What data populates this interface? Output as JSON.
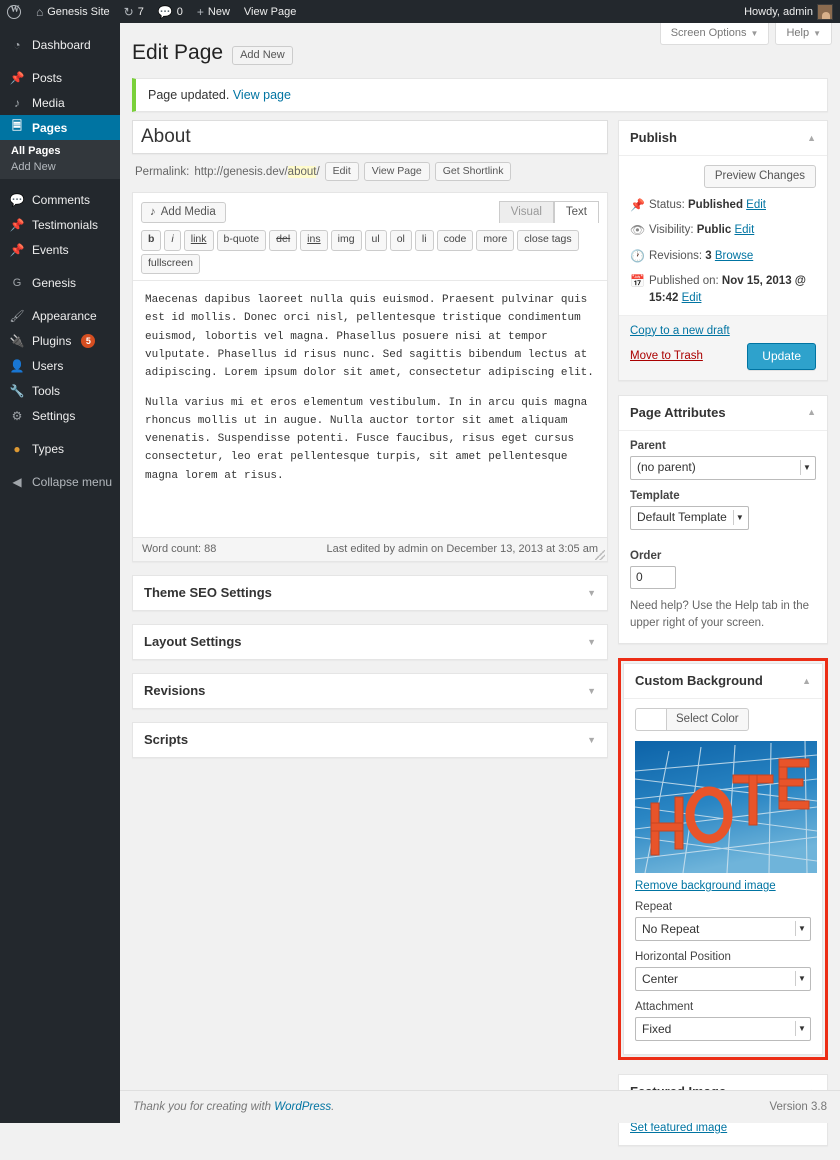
{
  "adminbar": {
    "logo_icon": "wordpress-logo-icon",
    "site_name": "Genesis Site",
    "updates_count": "7",
    "comments_count": "0",
    "new_label": "New",
    "view_page_label": "View Page",
    "howdy": "Howdy, admin"
  },
  "sidebar": {
    "items": [
      {
        "label": "Dashboard",
        "icon": "dashboard-icon"
      },
      {
        "label": "Posts",
        "icon": "pin-icon"
      },
      {
        "label": "Media",
        "icon": "media-icon"
      },
      {
        "label": "Pages",
        "icon": "pages-icon",
        "current": true
      },
      {
        "label": "Comments",
        "icon": "comment-icon"
      },
      {
        "label": "Testimonials",
        "icon": "pin-icon"
      },
      {
        "label": "Events",
        "icon": "pin-icon"
      },
      {
        "label": "Genesis",
        "icon": "genesis-icon"
      },
      {
        "label": "Appearance",
        "icon": "brush-icon"
      },
      {
        "label": "Plugins",
        "icon": "plug-icon",
        "badge": "5"
      },
      {
        "label": "Users",
        "icon": "user-icon"
      },
      {
        "label": "Tools",
        "icon": "wrench-icon"
      },
      {
        "label": "Settings",
        "icon": "settings-icon"
      },
      {
        "label": "Types",
        "icon": "types-icon"
      },
      {
        "label": "Collapse menu",
        "icon": "collapse-icon"
      }
    ],
    "pages_submenu": [
      {
        "label": "All Pages",
        "current": true
      },
      {
        "label": "Add New",
        "current": false
      }
    ]
  },
  "screen_meta": {
    "screen_options": "Screen Options",
    "help": "Help"
  },
  "header": {
    "title": "Edit Page",
    "add_new": "Add New"
  },
  "notice": {
    "text": "Page updated.",
    "link": "View page"
  },
  "post": {
    "title": "About",
    "permalink_label": "Permalink:",
    "permalink_base": "http://genesis.dev/",
    "permalink_slug": "about",
    "permalink_tail": "/",
    "edit_btn": "Edit",
    "view_page_btn": "View Page",
    "get_shortlink_btn": "Get Shortlink"
  },
  "editor": {
    "add_media": "Add Media",
    "tab_visual": "Visual",
    "tab_text": "Text",
    "active_tab": "Text",
    "quicktags": [
      "b",
      "i",
      "link",
      "b-quote",
      "del",
      "ins",
      "img",
      "ul",
      "ol",
      "li",
      "code",
      "more",
      "close tags",
      "fullscreen"
    ],
    "paragraphs": [
      "Maecenas dapibus laoreet nulla quis euismod. Praesent pulvinar quis est id mollis. Donec orci nisl, pellentesque tristique condimentum euismod, lobortis vel magna. Phasellus posuere nisi at tempor vulputate. Phasellus id risus nunc. Sed sagittis bibendum lectus at adipiscing. Lorem ipsum dolor sit amet, consectetur adipiscing elit.",
      "Nulla varius mi et eros elementum vestibulum. In in arcu quis magna rhoncus mollis ut in augue. Nulla auctor tortor sit amet aliquam venenatis. Suspendisse potenti. Fusce faucibus, risus eget cursus consectetur, leo erat pellentesque turpis, sit amet pellentesque magna lorem at risus."
    ],
    "word_count": "Word count: 88",
    "last_edited": "Last edited by admin on December 13, 2013 at 3:05 am"
  },
  "metaboxes": [
    {
      "title": "Theme SEO Settings"
    },
    {
      "title": "Layout Settings"
    },
    {
      "title": "Revisions"
    },
    {
      "title": "Scripts"
    }
  ],
  "publish": {
    "title": "Publish",
    "preview_changes": "Preview Changes",
    "status_label": "Status:",
    "status_value": "Published",
    "status_edit": "Edit",
    "visibility_label": "Visibility:",
    "visibility_value": "Public",
    "visibility_edit": "Edit",
    "revisions_label": "Revisions:",
    "revisions_value": "3",
    "revisions_browse": "Browse",
    "published_label": "Published on:",
    "published_value": "Nov 15, 2013 @ 15:42",
    "published_edit": "Edit",
    "copy_draft": "Copy to a new draft",
    "move_to_trash": "Move to Trash",
    "update": "Update"
  },
  "page_attributes": {
    "title": "Page Attributes",
    "parent_label": "Parent",
    "parent_value": "(no parent)",
    "template_label": "Template",
    "template_value": "Default Template",
    "order_label": "Order",
    "order_value": "0",
    "help_text": "Need help? Use the Help tab in the upper right of your screen."
  },
  "custom_background": {
    "title": "Custom Background",
    "select_color": "Select Color",
    "color_value": "",
    "image_alt": "HOTEL sign",
    "remove_image": "Remove background image",
    "repeat_label": "Repeat",
    "repeat_value": "No Repeat",
    "horizontal_label": "Horizontal Position",
    "horizontal_value": "Center",
    "attachment_label": "Attachment",
    "attachment_value": "Fixed",
    "highlight_color": "#ec2d16"
  },
  "featured_image": {
    "title": "Featured Image",
    "set_link": "Set featured image"
  },
  "footer": {
    "thanks_prefix": "Thank you for creating with ",
    "wordpress": "WordPress",
    "thanks_suffix": ".",
    "version": "Version 3.8"
  },
  "colors": {
    "admin_blue": "#0074a2",
    "button_blue": "#2ea2cc",
    "notice_green": "#7ad03a",
    "badge_orange": "#d54e21",
    "highlight_red": "#ec2d16"
  }
}
